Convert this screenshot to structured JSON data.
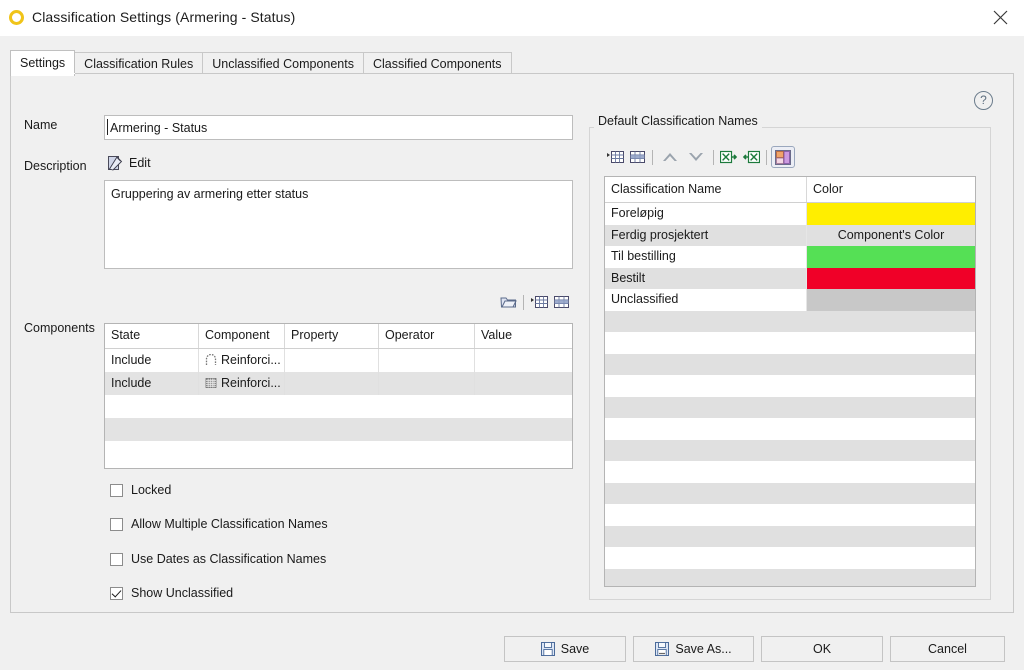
{
  "window": {
    "title": "Classification Settings (Armering - Status)",
    "icon": "yellow-ring-icon",
    "close_label": "✕"
  },
  "tabs": [
    {
      "label": "Settings",
      "active": true
    },
    {
      "label": "Classification Rules",
      "active": false
    },
    {
      "label": "Unclassified Components",
      "active": false
    },
    {
      "label": "Classified Components",
      "active": false
    }
  ],
  "help": {
    "glyph": "?"
  },
  "form": {
    "name_label": "Name",
    "name_value": "Armering - Status",
    "description_label": "Description",
    "edit_label": "Edit",
    "description_value": "Gruppering av armering etter status",
    "components_label": "Components"
  },
  "components_toolbar": [
    {
      "name": "open-folder-icon",
      "title": "Open"
    },
    {
      "name": "add-row-icon",
      "title": "Add Row"
    },
    {
      "name": "delete-row-icon",
      "title": "Delete Row"
    }
  ],
  "components_table": {
    "columns": [
      "State",
      "Component",
      "Property",
      "Operator",
      "Value"
    ],
    "rows": [
      {
        "state": "Include",
        "component": "Reinforci...",
        "icon": "stirrup-icon",
        "property": "",
        "operator": "",
        "value": "",
        "alt": false
      },
      {
        "state": "Include",
        "component": "Reinforci...",
        "icon": "mesh-icon",
        "property": "",
        "operator": "",
        "value": "",
        "alt": true
      }
    ],
    "empty_rows": 3
  },
  "checkboxes": [
    {
      "label": "Locked",
      "checked": false
    },
    {
      "label": "Allow Multiple Classification Names",
      "checked": false
    },
    {
      "label": "Use Dates as Classification Names",
      "checked": false
    },
    {
      "label": "Show Unclassified",
      "checked": true
    }
  ],
  "default_classification": {
    "group_title": "Default Classification Names",
    "toolbar": [
      {
        "name": "add-row-icon",
        "title": "Add Row"
      },
      {
        "name": "delete-row-icon",
        "title": "Delete Row"
      },
      {
        "name": "move-up-icon",
        "title": "Move Up"
      },
      {
        "name": "move-down-icon",
        "title": "Move Down"
      },
      {
        "name": "export-excel-icon",
        "title": "Export to Excel"
      },
      {
        "name": "import-excel-icon",
        "title": "Import from Excel"
      },
      {
        "name": "color-palette-icon",
        "title": "Colors",
        "pressed": true
      }
    ],
    "columns": [
      "Classification Name",
      "Color"
    ],
    "rows": [
      {
        "name": "Foreløpig",
        "color": "#ffee00",
        "color_text": "",
        "alt": false
      },
      {
        "name": "Ferdig prosjektert",
        "color": "",
        "color_text": "Component's Color",
        "alt": true
      },
      {
        "name": "Til bestilling",
        "color": "#55e055",
        "color_text": "",
        "alt": false
      },
      {
        "name": "Bestilt",
        "color": "#f00028",
        "color_text": "",
        "alt": true
      },
      {
        "name": "Unclassified",
        "color": "#c8c8c8",
        "color_text": "",
        "alt": false
      }
    ],
    "empty_rows": 13
  },
  "buttons": [
    {
      "label": "Save",
      "icon": "floppy-icon"
    },
    {
      "label": "Save As...",
      "icon": "floppy-dots-icon"
    },
    {
      "label": "OK",
      "icon": ""
    },
    {
      "label": "Cancel",
      "icon": ""
    }
  ],
  "colors": {
    "accent_yellow": "#ffee00",
    "accent_green": "#55e055",
    "accent_red": "#f00028",
    "unclassified_gray": "#c8c8c8",
    "window_bg": "#f0f0f0",
    "title_icon": "#f0c419"
  }
}
